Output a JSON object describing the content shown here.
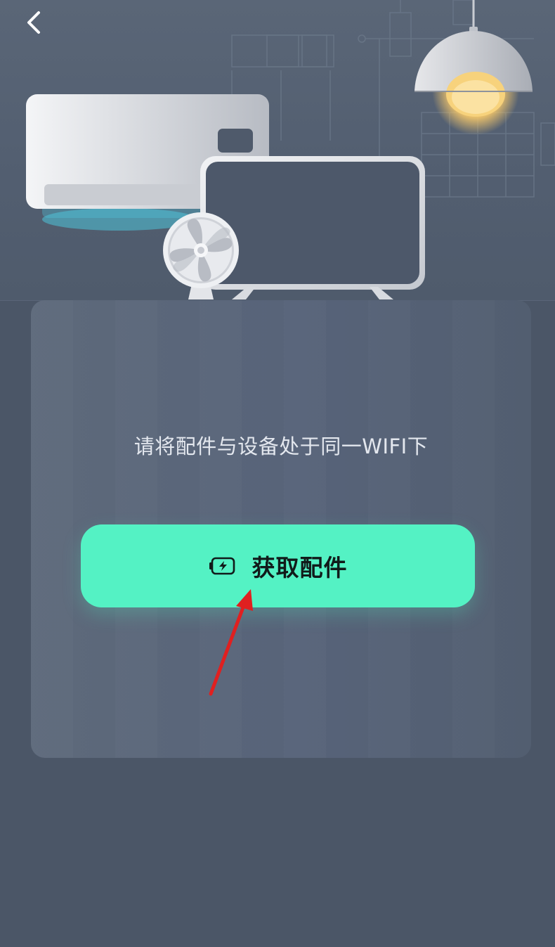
{
  "header": {
    "back_icon": "chevron-left-icon"
  },
  "hero": {
    "illustration": [
      "air-conditioner",
      "tv-display",
      "fan",
      "pendant-lamp"
    ]
  },
  "card": {
    "instruction": "请将配件与设备处于同一WIFI下",
    "button_label": "获取配件",
    "button_icon": "battery-charging-icon"
  },
  "annotation": {
    "arrow_color": "#e02020"
  },
  "colors": {
    "background": "#4b5667",
    "card": "#5a6678",
    "accent": "#54f2c4",
    "ac_glow": "#4fc3d9",
    "lamp_glow": "#f5c76a"
  }
}
